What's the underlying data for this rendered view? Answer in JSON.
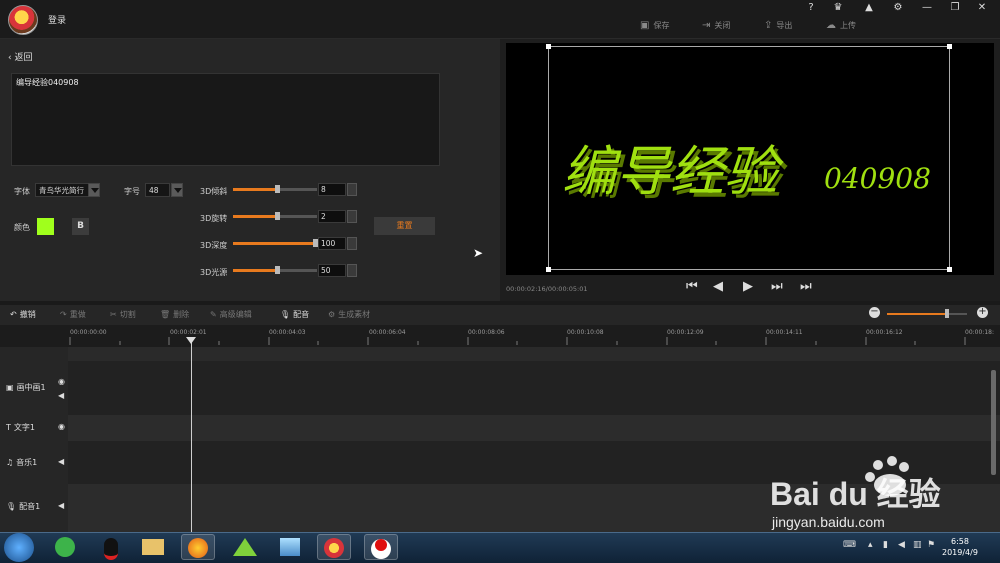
{
  "titlebar": {
    "login": "登录",
    "window_controls": [
      "?",
      "⬡",
      "🔔",
      "⚙",
      "—",
      "❐",
      "✕"
    ],
    "actions": [
      {
        "icon": "save-icon",
        "label": "保存"
      },
      {
        "icon": "close-doc-icon",
        "label": "关闭"
      },
      {
        "icon": "export-icon",
        "label": "导出"
      },
      {
        "icon": "upload-icon",
        "label": "上传"
      }
    ]
  },
  "editor": {
    "back_label": "返回",
    "text_value": "编导经验040908",
    "font_label": "字体",
    "font_value": "青鸟华光简行",
    "size_label": "字号",
    "size_value": "48",
    "color_label": "颜色",
    "color_value": "#a0ff1c",
    "bold_label": "B",
    "reset_label": "重置",
    "sliders": [
      {
        "label": "3D倾斜",
        "value": "8",
        "level": 0.5
      },
      {
        "label": "3D旋转",
        "value": "2",
        "level": 0.5
      },
      {
        "label": "3D深度",
        "value": "100",
        "level": 1.0
      },
      {
        "label": "3D光源",
        "value": "50",
        "level": 0.5
      }
    ]
  },
  "preview": {
    "overlay_text": "编导经验",
    "overlay_number": "040908",
    "time": "00:00:02:16/00:00:05:01"
  },
  "toolbar": {
    "items": [
      {
        "icon": "undo-icon",
        "label": "撤销",
        "active": true
      },
      {
        "icon": "redo-icon",
        "label": "重做",
        "active": false
      },
      {
        "icon": "cut-icon",
        "label": "切割",
        "active": false
      },
      {
        "icon": "delete-icon",
        "label": "删除",
        "active": false
      },
      {
        "icon": "edit-icon",
        "label": "高级编辑",
        "active": false
      },
      {
        "icon": "mic-icon",
        "label": "配音",
        "active": true
      },
      {
        "icon": "generate-icon",
        "label": "生成素材",
        "active": false
      }
    ],
    "zoom_minus": "−",
    "zoom_plus": "+"
  },
  "timeline": {
    "ticks": [
      "00:00:00:00",
      "00:00:02:01",
      "00:00:04:03",
      "00:00:06:04",
      "00:00:08:06",
      "00:00:10:08",
      "00:00:12:09",
      "00:00:14:11",
      "00:00:16:12",
      "00:00:18:"
    ],
    "tracks": [
      {
        "icon": "pip-icon",
        "label": "画中画1"
      },
      {
        "icon": "text-icon",
        "label": "文字1"
      },
      {
        "icon": "music-icon",
        "label": "音乐1"
      },
      {
        "icon": "mic-icon",
        "label": "配音1"
      }
    ]
  },
  "taskbar": {
    "time": "6:58",
    "date": "2019/4/9"
  },
  "watermark": {
    "brand": "Bai du 经验",
    "url": "jingyan.baidu.com"
  }
}
